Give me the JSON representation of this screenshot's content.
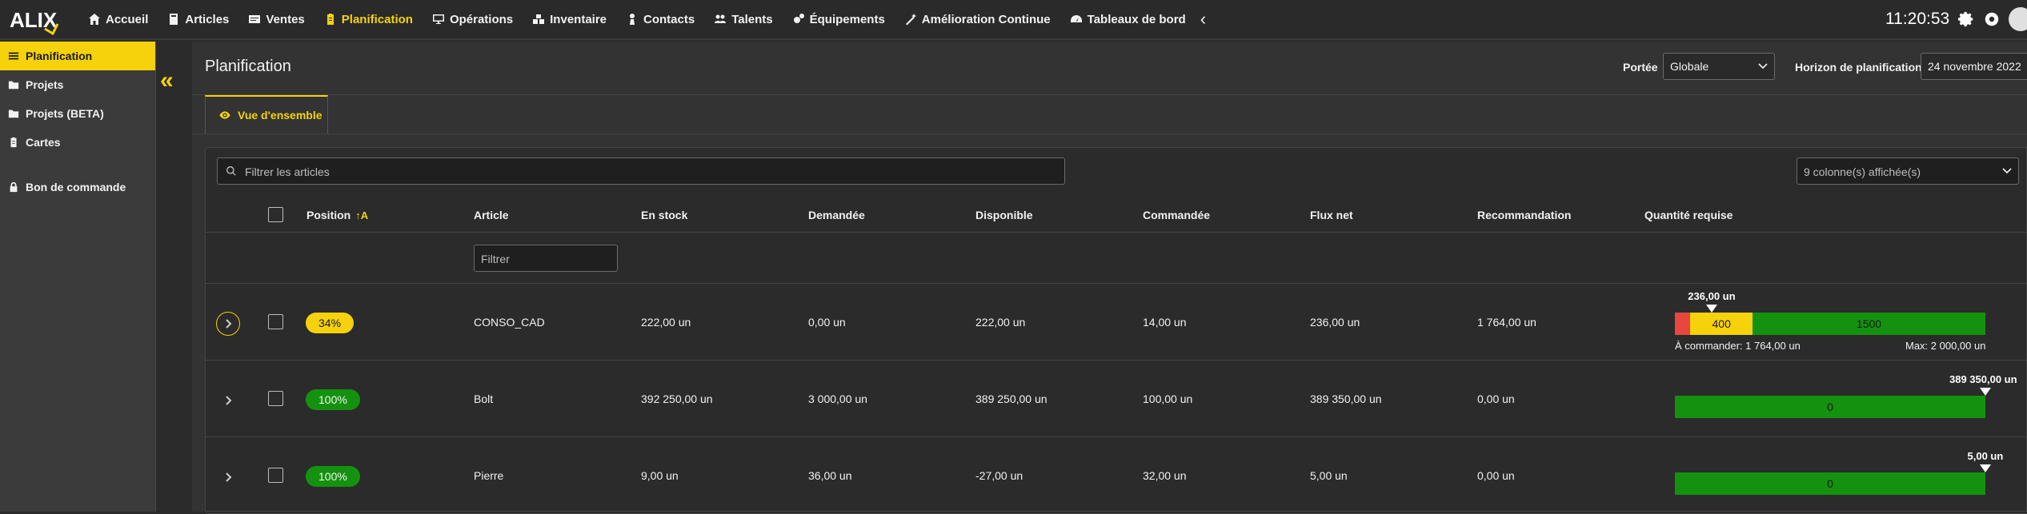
{
  "app": {
    "logo_text": "ALIX",
    "clock": "11:20:53"
  },
  "nav": [
    {
      "label": "Accueil",
      "icon": "home-icon"
    },
    {
      "label": "Articles",
      "icon": "book-icon"
    },
    {
      "label": "Ventes",
      "icon": "cart-icon"
    },
    {
      "label": "Planification",
      "icon": "clipboard-icon",
      "active": true
    },
    {
      "label": "Opérations",
      "icon": "monitor-icon"
    },
    {
      "label": "Inventaire",
      "icon": "boxes-icon"
    },
    {
      "label": "Contacts",
      "icon": "person-icon"
    },
    {
      "label": "Talents",
      "icon": "people-icon"
    },
    {
      "label": "Équipements",
      "icon": "cogs-icon"
    },
    {
      "label": "Amélioration Continue",
      "icon": "magic-icon"
    },
    {
      "label": "Tableaux de bord",
      "icon": "gauge-icon"
    }
  ],
  "sidebar": [
    {
      "label": "Planification",
      "icon": "list-icon",
      "active": true
    },
    {
      "label": "Projets",
      "icon": "folder-icon"
    },
    {
      "label": "Projets (BETA)",
      "icon": "folder-icon"
    },
    {
      "label": "Cartes",
      "icon": "clipboard-icon"
    },
    {
      "label": "Bon de commande",
      "icon": "lock-icon"
    }
  ],
  "page": {
    "title": "Planification",
    "scope_label": "Portée",
    "scope_value": "Globale",
    "horizon_label": "Horizon de planification",
    "horizon_value": "24 novembre 2022",
    "tab_label": "Vue d'ensemble"
  },
  "grid": {
    "filter_placeholder": "Filtrer les articles",
    "columns_selected": "9 colonne(s) affichée(s)",
    "column_filter_placeholder": "Filtrer",
    "headers": {
      "position": "Position",
      "article": "Article",
      "en_stock": "En stock",
      "demandee": "Demandée",
      "disponible": "Disponible",
      "commandee": "Commandée",
      "flux_net": "Flux net",
      "recommandation": "Recommandation",
      "quantite_requise": "Quantité requise"
    },
    "rows": [
      {
        "position": "34%",
        "status": "yellow",
        "article": "CONSO_CAD",
        "en_stock": "222,00 un",
        "demandee": "0,00 un",
        "disponible": "222,00 un",
        "commandee": "14,00 un",
        "flux_net": "236,00 un",
        "recommandation": "1 764,00 un",
        "qty_marker_label": "236,00 un",
        "qty_marker_fraction": 0.118,
        "segments": [
          {
            "color": "red",
            "fraction": 0.05,
            "label": ""
          },
          {
            "color": "yellow",
            "fraction": 0.2,
            "label": "400"
          },
          {
            "color": "green",
            "fraction": 0.75,
            "label": "1500"
          }
        ],
        "to_order": "À commander: 1 764,00 un",
        "max": "Max: 2 000,00 un"
      },
      {
        "position": "100%",
        "status": "green",
        "article": "Bolt",
        "en_stock": "392 250,00 un",
        "demandee": "3 000,00 un",
        "disponible": "389 250,00 un",
        "commandee": "100,00 un",
        "flux_net": "389 350,00 un",
        "recommandation": "0,00 un",
        "qty_marker_label": "389 350,00 un",
        "qty_marker_fraction": 1.0,
        "segments": [
          {
            "color": "green",
            "fraction": 1.0,
            "label": "0"
          }
        ]
      },
      {
        "position": "100%",
        "status": "green",
        "article": "Pierre",
        "en_stock": "9,00 un",
        "demandee": "36,00 un",
        "disponible": "-27,00 un",
        "commandee": "32,00 un",
        "flux_net": "5,00 un",
        "recommandation": "0,00 un",
        "qty_marker_label": "5,00 un",
        "qty_marker_fraction": 1.0,
        "segments": [
          {
            "color": "green",
            "fraction": 1.0,
            "label": "0"
          }
        ]
      }
    ]
  }
}
